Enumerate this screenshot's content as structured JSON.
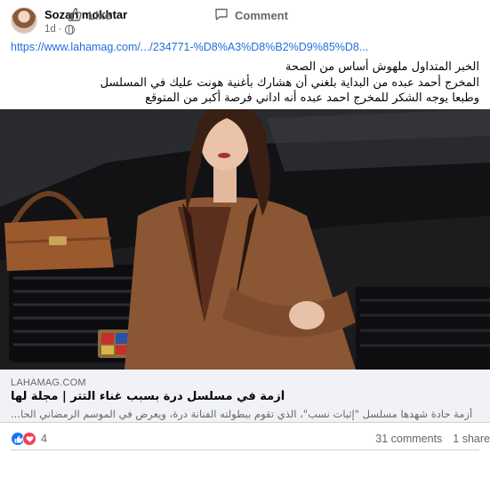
{
  "post": {
    "author": "Sozan mokhtar",
    "time": "1d",
    "dot": "·",
    "link": "https://www.lahamag.com/.../234771-%D8%A3%D8%B2%D9%85%D8...",
    "text_lines": [
      "الخبر المتداول ملهوش أساس من الصحة",
      "المخرج أحمد عبده من البداية بلغني أن هشارك بأغنية هونت عليك في المسلسل",
      "وطبعا يوجه الشكر للمخرج احمد عبده أنه اداني فرصة أكبر من المتوقع"
    ],
    "icons": {
      "privacy": "globe-icon",
      "avatar": "profile-photo"
    }
  },
  "preview": {
    "domain": "LAHAMAG.COM",
    "title": "أزمة في مسلسل درة بسبب غناء التتر | مجلة لها",
    "description": "أزمة حادة شهدها مسلسل \"إثبات نسب\"، الذي تقوم ببطولته الفنانة درة، ويعرض في الموسم الرمضاني الحا..."
  },
  "reactions": {
    "count": "4",
    "types": [
      "like-icon",
      "love-icon"
    ],
    "comments": "31 comments",
    "shares": "1 share"
  },
  "actions": {
    "like": "Like",
    "comment": "Comment"
  },
  "colors": {
    "link": "#216fdb",
    "like_blue": "#1877f2",
    "love_red": "#f33e58",
    "secondary_text": "#65676b"
  }
}
